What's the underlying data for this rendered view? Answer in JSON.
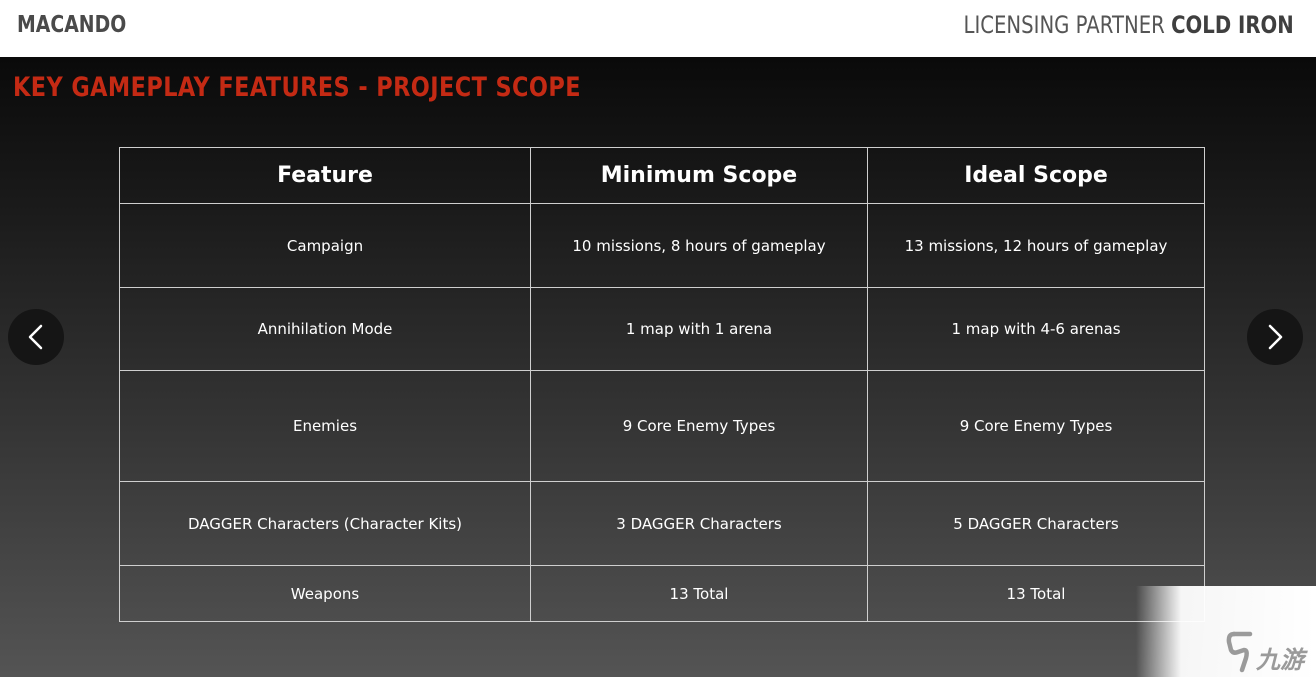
{
  "header": {
    "brand": "MACANDO",
    "partner_prefix": "LICENSING PARTNER",
    "partner_name": "COLD IRON"
  },
  "slide": {
    "title": "KEY GAMEPLAY FEATURES - PROJECT SCOPE",
    "table": {
      "columns": [
        "Feature",
        "Minimum Scope",
        "Ideal Scope"
      ],
      "rows": [
        [
          "Campaign",
          "10 missions, 8 hours of gameplay",
          "13 missions, 12 hours of gameplay"
        ],
        [
          "Annihilation Mode",
          "1 map with 1 arena",
          "1 map with 4-6 arenas"
        ],
        [
          "Enemies",
          "9 Core Enemy Types",
          "9 Core Enemy Types"
        ],
        [
          "DAGGER Characters (Character Kits)",
          "3 DAGGER Characters",
          "5 DAGGER Characters"
        ],
        [
          "Weapons",
          "13 Total",
          "13 Total"
        ]
      ]
    }
  },
  "navigation": {
    "prev_icon": "chevron-left-icon",
    "next_icon": "chevron-right-icon"
  },
  "watermark": {
    "text": "九游",
    "icon": "nine-game-logo-icon"
  },
  "colors": {
    "title_red": "#c42a14",
    "brand_gray": "#4a4a4a",
    "table_border": "#cfcfcf"
  }
}
